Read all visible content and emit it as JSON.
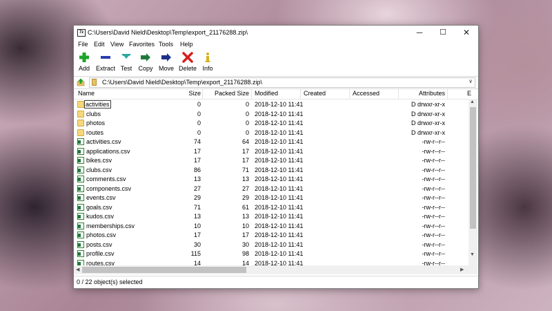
{
  "window": {
    "title": "C:\\Users\\David Nield\\Desktop\\Temp\\export_21176288.zip\\",
    "app_icon_text": "7z",
    "minimize": "─",
    "maximize": "☐",
    "close": "✕"
  },
  "menu": [
    "File",
    "Edit",
    "View",
    "Favorites",
    "Tools",
    "Help"
  ],
  "toolbar": [
    {
      "label": "Add",
      "icon": "add-icon",
      "color": "#1fa32a"
    },
    {
      "label": "Extract",
      "icon": "extract-icon",
      "color": "#2b3db0"
    },
    {
      "label": "Test",
      "icon": "test-icon",
      "color": "#2aa8a0"
    },
    {
      "label": "Copy",
      "icon": "copy-icon",
      "color": "#1e7a3c"
    },
    {
      "label": "Move",
      "icon": "move-icon",
      "color": "#1c2f8a"
    },
    {
      "label": "Delete",
      "icon": "delete-icon",
      "color": "#d42020"
    },
    {
      "label": "Info",
      "icon": "info-icon",
      "color": "#d8b21c"
    }
  ],
  "address": {
    "path": "C:\\Users\\David Nield\\Desktop\\Temp\\export_21176288.zip\\"
  },
  "columns": {
    "name": "Name",
    "size": "Size",
    "packed": "Packed Size",
    "modified": "Modified",
    "created": "Created",
    "accessed": "Accessed",
    "attributes": "Attributes",
    "extra": "E"
  },
  "files": [
    {
      "name": "activities",
      "type": "folder",
      "size": "0",
      "packed": "0",
      "modified": "2018-12-10 11:41",
      "attributes": "D drwxr-xr-x"
    },
    {
      "name": "clubs",
      "type": "folder",
      "size": "0",
      "packed": "0",
      "modified": "2018-12-10 11:41",
      "attributes": "D drwxr-xr-x"
    },
    {
      "name": "photos",
      "type": "folder",
      "size": "0",
      "packed": "0",
      "modified": "2018-12-10 11:41",
      "attributes": "D drwxr-xr-x"
    },
    {
      "name": "routes",
      "type": "folder",
      "size": "0",
      "packed": "0",
      "modified": "2018-12-10 11:41",
      "attributes": "D drwxr-xr-x"
    },
    {
      "name": "activities.csv",
      "type": "csv",
      "size": "74",
      "packed": "64",
      "modified": "2018-12-10 11:41",
      "attributes": "-rw-r--r--"
    },
    {
      "name": "applications.csv",
      "type": "csv",
      "size": "17",
      "packed": "17",
      "modified": "2018-12-10 11:41",
      "attributes": "-rw-r--r--"
    },
    {
      "name": "bikes.csv",
      "type": "csv",
      "size": "17",
      "packed": "17",
      "modified": "2018-12-10 11:41",
      "attributes": "-rw-r--r--"
    },
    {
      "name": "clubs.csv",
      "type": "csv",
      "size": "86",
      "packed": "71",
      "modified": "2018-12-10 11:41",
      "attributes": "-rw-r--r--"
    },
    {
      "name": "comments.csv",
      "type": "csv",
      "size": "13",
      "packed": "13",
      "modified": "2018-12-10 11:41",
      "attributes": "-rw-r--r--"
    },
    {
      "name": "components.csv",
      "type": "csv",
      "size": "27",
      "packed": "27",
      "modified": "2018-12-10 11:41",
      "attributes": "-rw-r--r--"
    },
    {
      "name": "events.csv",
      "type": "csv",
      "size": "29",
      "packed": "29",
      "modified": "2018-12-10 11:41",
      "attributes": "-rw-r--r--"
    },
    {
      "name": "goals.csv",
      "type": "csv",
      "size": "71",
      "packed": "61",
      "modified": "2018-12-10 11:41",
      "attributes": "-rw-r--r--"
    },
    {
      "name": "kudos.csv",
      "type": "csv",
      "size": "13",
      "packed": "13",
      "modified": "2018-12-10 11:41",
      "attributes": "-rw-r--r--"
    },
    {
      "name": "memberships.csv",
      "type": "csv",
      "size": "10",
      "packed": "10",
      "modified": "2018-12-10 11:41",
      "attributes": "-rw-r--r--"
    },
    {
      "name": "photos.csv",
      "type": "csv",
      "size": "17",
      "packed": "17",
      "modified": "2018-12-10 11:41",
      "attributes": "-rw-r--r--"
    },
    {
      "name": "posts.csv",
      "type": "csv",
      "size": "30",
      "packed": "30",
      "modified": "2018-12-10 11:41",
      "attributes": "-rw-r--r--"
    },
    {
      "name": "profile.csv",
      "type": "csv",
      "size": "115",
      "packed": "98",
      "modified": "2018-12-10 11:41",
      "attributes": "-rw-r--r--"
    },
    {
      "name": "routes.csv",
      "type": "csv",
      "size": "14",
      "packed": "14",
      "modified": "2018-12-10 11:41",
      "attributes": "-rw-r--r--"
    }
  ],
  "status": {
    "text": "0 / 22 object(s) selected"
  }
}
